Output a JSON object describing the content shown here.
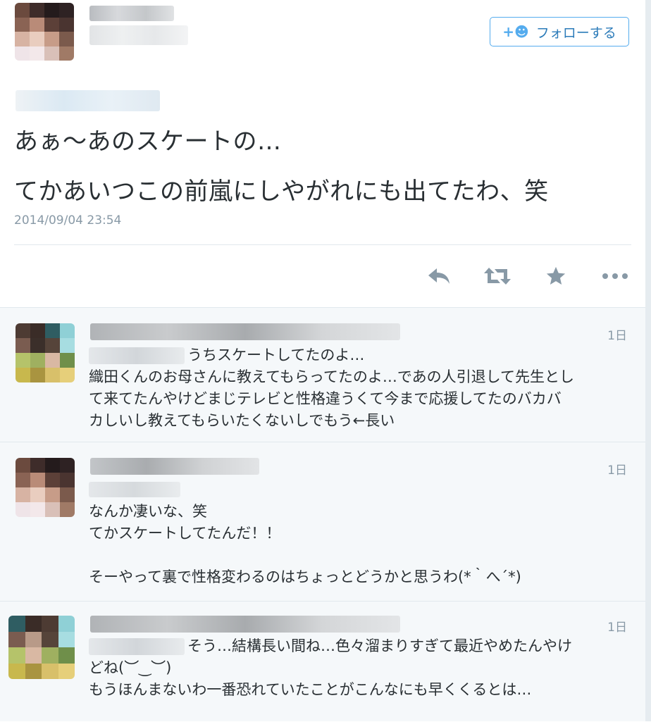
{
  "main_tweet": {
    "follow_label": "フォローする",
    "follow_icon": "follow-user-icon",
    "lines": [
      "あぁ〜あのスケートの…",
      "てかあいつこの前嵐にしやがれにも出てたわ、笑"
    ],
    "timestamp": "2014/09/04 23:54",
    "actions": [
      "reply-icon",
      "retweet-icon",
      "favorite-icon",
      "more-icon"
    ]
  },
  "replies": [
    {
      "time": "1日",
      "lines": [
        "うちスケートしてたのよ…",
        "織田くんのお母さんに教えてもらってたのよ…であの人引退して先生とし",
        "て来てたんやけどまじテレビと性格違うくて今まで応援してたのバカバ",
        "カしいし教えてもらいたくないしでもう←長い"
      ]
    },
    {
      "time": "1日",
      "lines": [
        "なんか凄いな、笑",
        "てかスケートしてたんだ！！",
        "",
        "そーやって裏で性格変わるのはちょっとどうかと思うわ(*｀へ´*)"
      ]
    },
    {
      "time": "1日",
      "lines": [
        "そう…結構長い間ね…色々溜まりすぎて最近やめたんやけ",
        "どね(︶‿︶)",
        "もうほんまないわ一番恐れていたことがこんなにも早くくるとは…"
      ]
    }
  ],
  "colors": {
    "accent": "#55acee",
    "muted": "#8899a6",
    "text": "#292f33",
    "reply_bg": "#f5f8fa"
  }
}
